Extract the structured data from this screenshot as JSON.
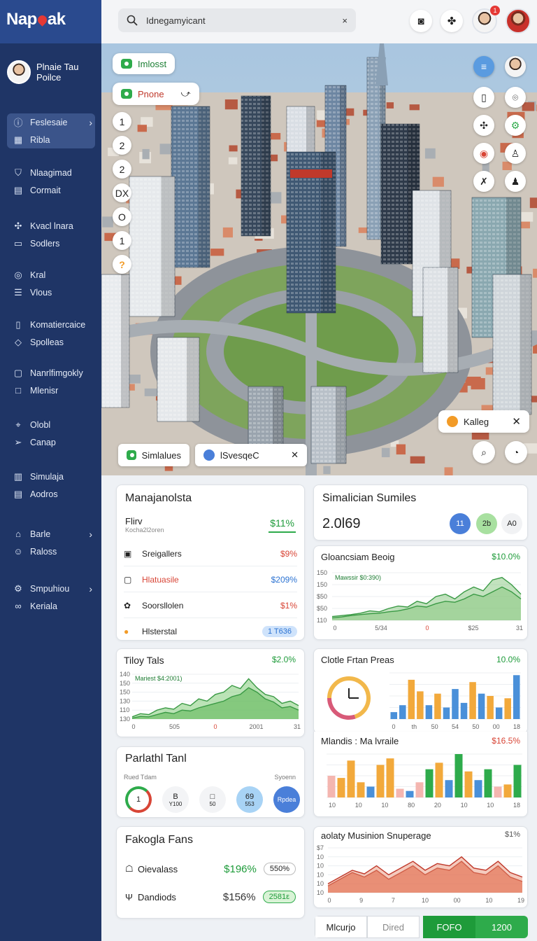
{
  "logo": {
    "pre": "Nap",
    "post": "ak"
  },
  "user": {
    "name": "Plnaie Tau",
    "role": "Poilce"
  },
  "nav": [
    {
      "label": "Feslesaie",
      "icon": "info-icon",
      "active": true,
      "chevron": true
    },
    {
      "label": "Ribla",
      "icon": "grid-icon",
      "active": true
    },
    {
      "label": "Nlaagimad",
      "icon": "shield-icon"
    },
    {
      "label": "Cormait",
      "icon": "database-icon"
    },
    {
      "label": "Kvacl lnara",
      "icon": "puzzle-icon"
    },
    {
      "label": "Sodlers",
      "icon": "folder-icon"
    },
    {
      "label": "Kral",
      "icon": "target-icon"
    },
    {
      "label": "Vlous",
      "icon": "list-icon"
    },
    {
      "label": "Komatiercaice",
      "icon": "document-icon"
    },
    {
      "label": "Spolleas",
      "icon": "layers-icon"
    },
    {
      "label": "Nanrlfimgokly",
      "icon": "clipboard-icon"
    },
    {
      "label": "Mlenisr",
      "icon": "square-icon"
    },
    {
      "label": "Olobl",
      "icon": "pin-icon"
    },
    {
      "label": "Canap",
      "icon": "send-icon"
    },
    {
      "label": "Simulaja",
      "icon": "chart-icon"
    },
    {
      "label": "Aodros",
      "icon": "inbox-icon"
    },
    {
      "label": "Barle",
      "icon": "tag-icon",
      "chevron": true
    },
    {
      "label": "Raloss",
      "icon": "people-icon"
    },
    {
      "label": "Smpuhiou",
      "icon": "settings-icon",
      "chevron": true
    },
    {
      "label": "Keriala",
      "icon": "link-icon"
    }
  ],
  "search": {
    "value": "Idnegamyicant",
    "clear": "×"
  },
  "topbar": {
    "badge": "1"
  },
  "map": {
    "chip_top": "Imlosst",
    "chip_phone": "Pnone",
    "zoom": [
      "1",
      "2",
      "2",
      "DX",
      "O",
      "1",
      "?"
    ],
    "tag_label": "Kalleg",
    "bottom_chip1": "Simlalues",
    "bottom_chip2": "lSvesqeC"
  },
  "management": {
    "title": "Manajanolsta",
    "sub_title": "Flirv",
    "sub_caption": "Kocha2l2oren",
    "sub_value": "$11%",
    "rows": [
      {
        "label": "Sreigallers",
        "value": "$9%",
        "color": "red"
      },
      {
        "label": "Hlatuasile",
        "value": "$209%",
        "color": "blue"
      },
      {
        "label": "Soorsllolen",
        "value": "$1%",
        "color": "red"
      },
      {
        "label": "Hlsterstal",
        "value": "1 T636",
        "color": "blue"
      }
    ]
  },
  "sim_summary": {
    "title": "Simalician Sumiles",
    "value": "2.0l69",
    "badges": [
      "11",
      "2b",
      "A0"
    ]
  },
  "glance": {
    "title": "Gloancsiam Beoig",
    "value": "$10.0%",
    "annotation": "Mawssir $0:390)",
    "y_ticks": [
      "150",
      "150",
      "$50",
      "$50",
      "110"
    ],
    "x_ticks": [
      "0",
      "5/34",
      "0",
      "$25",
      "31"
    ]
  },
  "tiloy": {
    "title": "Tiloy Tals",
    "value": "$2.0%",
    "annotation": "Mariest $4:2001)",
    "y_ticks": [
      "140",
      "150",
      "150",
      "130",
      "110",
      "130"
    ],
    "x_ticks": [
      "0",
      "505",
      "0",
      "2001",
      "31"
    ]
  },
  "clottie": {
    "title": "Clotle Frtan Preas",
    "value": "10.0%",
    "x_ticks": [
      "0",
      "th",
      "50",
      "54",
      "50",
      "00",
      "18"
    ]
  },
  "mlandis": {
    "title": "Mlandis : Ma lvraile",
    "value": "$16.5%",
    "x_ticks": [
      "10",
      "10",
      "10",
      "80",
      "20",
      "10",
      "10",
      "18"
    ]
  },
  "parlathl": {
    "title": "Parlathl Tanl",
    "left_caption": "Rued Tdam",
    "right_caption": "Syoenn",
    "circles": [
      {
        "top": "1",
        "bottom": ""
      },
      {
        "top": "B",
        "bottom": "Y100"
      },
      {
        "top": "□",
        "bottom": "50"
      },
      {
        "top": "69",
        "bottom": "553"
      },
      {
        "top": "Rpdea",
        "bottom": ""
      }
    ]
  },
  "fakogla": {
    "title": "Fakogla Fans",
    "rows": [
      {
        "label": "Oievalass",
        "value": "$196%",
        "pill": "550%"
      },
      {
        "label": "Dandiods",
        "value": "$156%",
        "pill": "2581ε"
      }
    ]
  },
  "aolaty": {
    "title": "aolaty Musinion Snuperage",
    "value": "$1%",
    "y_ticks": [
      "$7",
      "10",
      "10",
      "10",
      "10",
      "10"
    ],
    "x_ticks": [
      "0",
      "9",
      "7",
      "10",
      "00",
      "10",
      "19"
    ]
  },
  "bottom_tabs": {
    "tab1": "Mlcurjo",
    "tab2": "Dired",
    "tab3": "FOFO",
    "tab4": "1200"
  },
  "chart_data": [
    {
      "type": "area",
      "title": "Gloancsiam Beoig",
      "series": [
        {
          "values": [
            0.08,
            0.1,
            0.12,
            0.15,
            0.2,
            0.18,
            0.25,
            0.3,
            0.28,
            0.4,
            0.35,
            0.5,
            0.55,
            0.45,
            0.6,
            0.7,
            0.62,
            0.85,
            0.9,
            0.75,
            0.55
          ]
        },
        {
          "values": [
            0.05,
            0.07,
            0.1,
            0.12,
            0.14,
            0.15,
            0.18,
            0.2,
            0.24,
            0.3,
            0.28,
            0.35,
            0.4,
            0.38,
            0.45,
            0.55,
            0.5,
            0.6,
            0.7,
            0.6,
            0.45
          ]
        }
      ]
    },
    {
      "type": "area",
      "title": "Tiloy Tals",
      "series": [
        {
          "values": [
            0.05,
            0.12,
            0.1,
            0.2,
            0.25,
            0.22,
            0.35,
            0.3,
            0.45,
            0.4,
            0.55,
            0.6,
            0.75,
            0.68,
            0.9,
            0.7,
            0.55,
            0.5,
            0.35,
            0.4,
            0.3
          ]
        },
        {
          "values": [
            0.02,
            0.06,
            0.05,
            0.1,
            0.15,
            0.12,
            0.2,
            0.18,
            0.25,
            0.3,
            0.35,
            0.4,
            0.5,
            0.55,
            0.7,
            0.6,
            0.45,
            0.38,
            0.25,
            0.28,
            0.2
          ]
        }
      ]
    },
    {
      "type": "pie",
      "title": "Clotle Frtan Preas",
      "values": [
        0.45,
        0.3,
        0.25
      ],
      "colors": [
        "#f2b84b",
        "#d85a78",
        "#f2b84b"
      ]
    },
    {
      "type": "bar",
      "title": "Clotle Frtan Preas",
      "values": [
        0.15,
        0.3,
        0.85,
        0.6,
        0.3,
        0.55,
        0.25,
        0.65,
        0.35,
        0.8,
        0.55,
        0.5,
        0.25,
        0.45,
        0.95
      ],
      "colors": [
        "#4a90d9",
        "#4a90d9",
        "#f2a93b",
        "#f2a93b",
        "#4a90d9",
        "#f2a93b",
        "#4a90d9",
        "#4a90d9",
        "#4a90d9",
        "#f2a93b",
        "#4a90d9",
        "#f2a93b",
        "#4a90d9",
        "#f2a93b",
        "#4a90d9"
      ]
    },
    {
      "type": "bar",
      "title": "Mlandis : Ma lvraile",
      "values": [
        0.5,
        0.45,
        0.85,
        0.35,
        0.25,
        0.75,
        0.9,
        0.2,
        0.15,
        0.35,
        0.65,
        0.8,
        0.4,
        1.0,
        0.6,
        0.4,
        0.65,
        0.25,
        0.3,
        0.75
      ],
      "colors": [
        "#f4b6b0",
        "#f2a93b",
        "#f2a93b",
        "#f2a93b",
        "#4a90d9",
        "#f2a93b",
        "#f2a93b",
        "#f4b6b0",
        "#4a90d9",
        "#f4b6b0",
        "#2eab4b",
        "#f2a93b",
        "#4a90d9",
        "#2eab4b",
        "#f2a93b",
        "#4a90d9",
        "#2eab4b",
        "#f4b6b0",
        "#f2a93b",
        "#2eab4b"
      ]
    },
    {
      "type": "area",
      "title": "aolaty Musinion Snuperage",
      "series": [
        {
          "values": [
            0.2,
            0.35,
            0.5,
            0.42,
            0.6,
            0.4,
            0.55,
            0.7,
            0.5,
            0.65,
            0.6,
            0.8,
            0.55,
            0.5,
            0.7,
            0.45,
            0.35
          ]
        },
        {
          "values": [
            0.15,
            0.3,
            0.45,
            0.35,
            0.5,
            0.3,
            0.45,
            0.6,
            0.4,
            0.55,
            0.5,
            0.7,
            0.45,
            0.4,
            0.6,
            0.35,
            0.25
          ]
        }
      ]
    }
  ]
}
